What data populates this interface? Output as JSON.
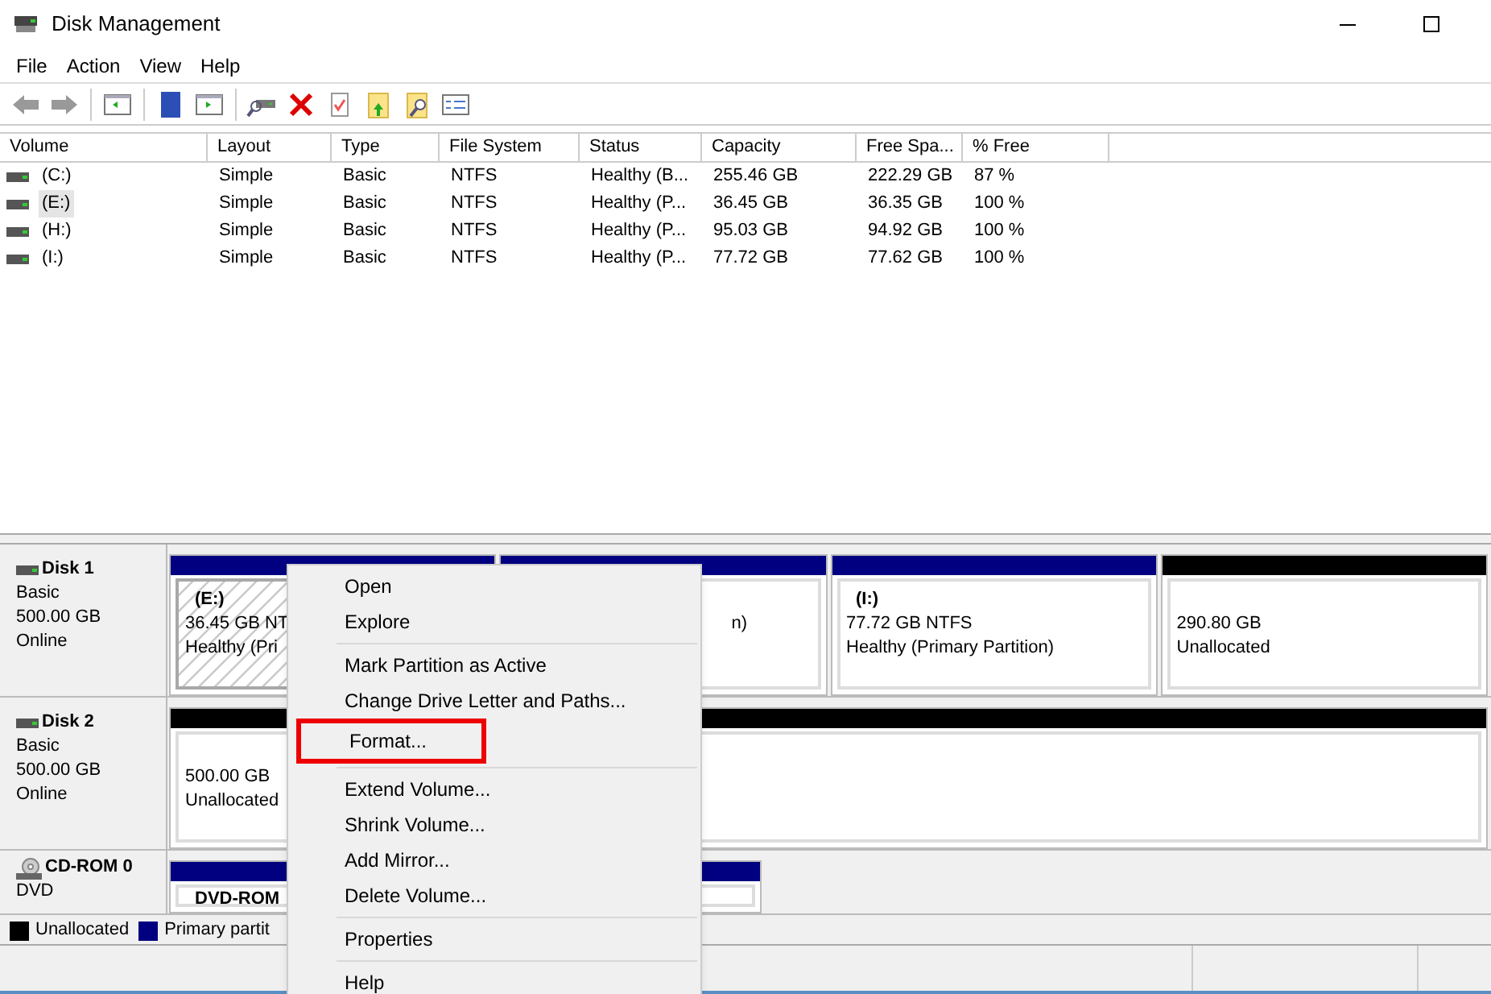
{
  "window": {
    "title": "Disk Management"
  },
  "menu": [
    "File",
    "Action",
    "View",
    "Help"
  ],
  "table": {
    "columns": [
      "Volume",
      "Layout",
      "Type",
      "File System",
      "Status",
      "Capacity",
      "Free Spa...",
      "% Free"
    ],
    "rows": [
      {
        "cells": [
          "(C:)",
          "Simple",
          "Basic",
          "NTFS",
          "Healthy (B...",
          "255.46 GB",
          "222.29 GB",
          "87 %"
        ],
        "selected": false
      },
      {
        "cells": [
          "(E:)",
          "Simple",
          "Basic",
          "NTFS",
          "Healthy (P...",
          "36.45 GB",
          "36.35 GB",
          "100 %"
        ],
        "selected": true
      },
      {
        "cells": [
          "(H:)",
          "Simple",
          "Basic",
          "NTFS",
          "Healthy (P...",
          "95.03 GB",
          "94.92 GB",
          "100 %"
        ],
        "selected": false
      },
      {
        "cells": [
          "(I:)",
          "Simple",
          "Basic",
          "NTFS",
          "Healthy (P...",
          "77.72 GB",
          "77.62 GB",
          "100 %"
        ],
        "selected": false
      }
    ]
  },
  "disks": [
    {
      "kind": "disk",
      "name": "Disk 1",
      "lines": [
        "Basic",
        "500.00 GB",
        "Online"
      ],
      "partitions": [
        {
          "kind": "primary",
          "selected": true,
          "label": "(E:)",
          "lines": [
            "36.45 GB NT",
            "Healthy (Pri"
          ]
        },
        {
          "kind": "primary",
          "selected": false,
          "lines": [
            "n)"
          ]
        },
        {
          "kind": "primary",
          "selected": false,
          "label": "(I:)",
          "lines": [
            "77.72 GB NTFS",
            "Healthy (Primary Partition)"
          ]
        },
        {
          "kind": "unallocated",
          "selected": false,
          "lines": [
            "290.80 GB",
            "Unallocated"
          ]
        }
      ]
    },
    {
      "kind": "disk",
      "name": "Disk 2",
      "lines": [
        "Basic",
        "500.00 GB",
        "Online"
      ],
      "partitions": [
        {
          "kind": "unallocated",
          "selected": false,
          "lines": [
            "500.00 GB",
            "Unallocated"
          ]
        }
      ]
    },
    {
      "kind": "cdrom",
      "name": "CD-ROM 0",
      "lines": [
        "DVD"
      ],
      "partitions": [
        {
          "kind": "primary",
          "selected": false,
          "label": "DVD-ROM"
        }
      ]
    }
  ],
  "legend": [
    {
      "label": "Unallocated",
      "color": "#000000"
    },
    {
      "label": "Primary partit",
      "color": "#000080"
    }
  ],
  "context_menu": {
    "groups": [
      [
        {
          "label": "Open",
          "highlighted": false
        },
        {
          "label": "Explore",
          "highlighted": false
        }
      ],
      [
        {
          "label": "Mark Partition as Active",
          "highlighted": false
        },
        {
          "label": "Change Drive Letter and Paths...",
          "highlighted": false
        },
        {
          "label": "Format...",
          "highlighted": true
        }
      ],
      [
        {
          "label": "Extend Volume...",
          "highlighted": false
        },
        {
          "label": "Shrink Volume...",
          "highlighted": false
        },
        {
          "label": "Add Mirror...",
          "highlighted": false
        },
        {
          "label": "Delete Volume...",
          "highlighted": false
        }
      ],
      [
        {
          "label": "Properties",
          "highlighted": false
        }
      ],
      [
        {
          "label": "Help",
          "highlighted": false
        }
      ]
    ]
  }
}
